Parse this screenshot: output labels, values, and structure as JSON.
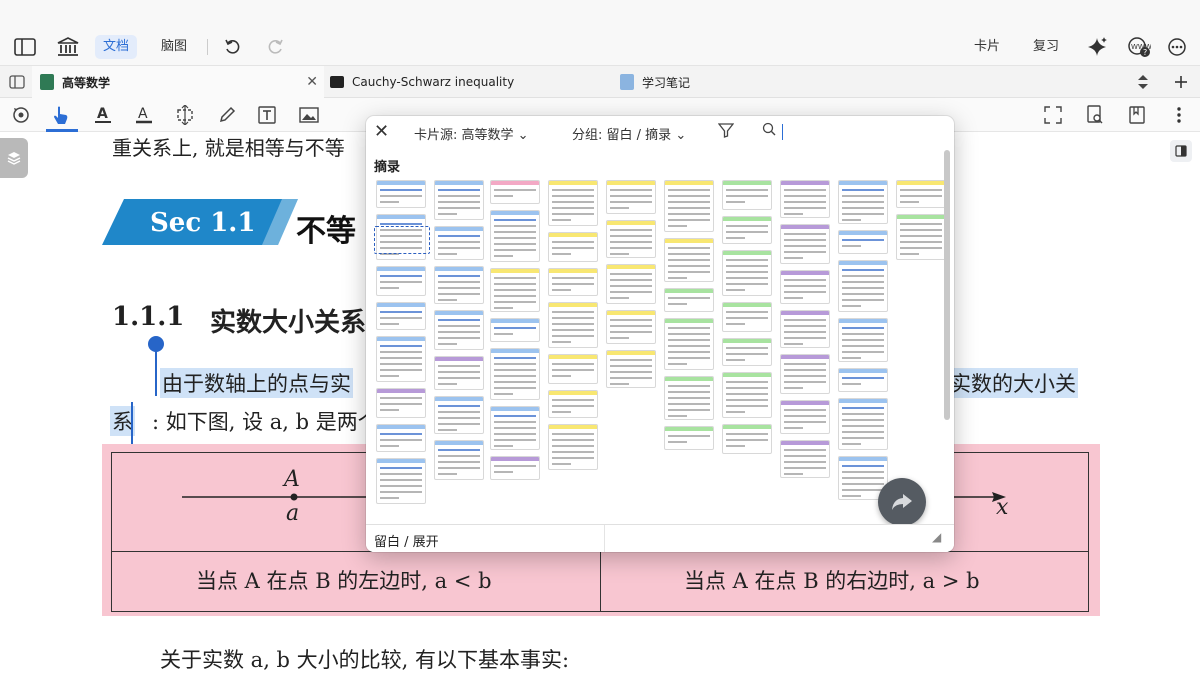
{
  "topbar": {
    "doc_label": "文档",
    "mindmap_label": "脑图",
    "cards_label": "卡片",
    "review_label": "复习"
  },
  "tabs": [
    {
      "label": "高等数学"
    },
    {
      "label": "Cauchy-Schwarz inequality"
    },
    {
      "label": "学习笔记"
    }
  ],
  "document": {
    "cut_line": "重关系上, 就是相等与不等",
    "section_label": "Sec 1.1",
    "section_title": "不等",
    "subsection_number": "1.1.1",
    "subsection_title": "实数大小关系",
    "para1_start": "由于数轴上的点与实",
    "para1_end": "实数的大小关",
    "para2_start": "系",
    "para2_rest": ": 如下图, 设 a, b 是两个",
    "axis_point_label": "A",
    "axis_point_value": "a",
    "axis_end_label": "x",
    "left_case": "当点 A 在点 B 的左边时, a < b",
    "right_case": "当点 A 在点 B 的右边时, a > b",
    "para3": "关于实数 a, b 大小的比较, 有以下基本事实:"
  },
  "popup": {
    "source_label": "卡片源: 高等数学",
    "group_label": "分组: 留白 / 摘录",
    "section_header": "摘录",
    "bottom_label": "留白 / 展开"
  },
  "colors": {
    "accent": "#2c6ed5",
    "highlight": "#cfe2f7",
    "pink_box": "#f8c6d1",
    "banner": "#1f87c9",
    "card_blue": "#9cc3ef",
    "card_pink": "#f3a9c5",
    "card_yellow": "#f8e772",
    "card_green": "#a8e3a0",
    "card_purple": "#b79ad8"
  }
}
